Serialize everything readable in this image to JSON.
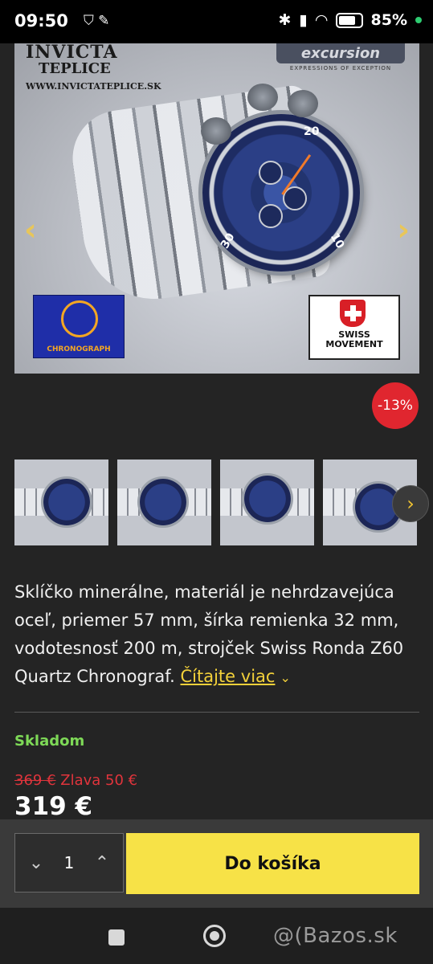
{
  "status_bar": {
    "time": "09:50",
    "battery": "85%"
  },
  "hero": {
    "brand_line1": "INVICTA",
    "brand_line2": "TEPLICE",
    "brand_url": "WWW.INVICTATEPLICE.SK",
    "logo_right": "excursion",
    "logo_right_tagline": "EXPRESSIONS OF EXCEPTION",
    "badge_left": "CHRONOGRAPH",
    "badge_right_line1": "SWISS",
    "badge_right_line2": "MOVEMENT",
    "bezel_numbers": [
      "20",
      "30",
      "10"
    ]
  },
  "discount_badge": "-13%",
  "thumbnails": [
    "thumb-1",
    "thumb-2",
    "thumb-3",
    "thumb-4"
  ],
  "description": {
    "text": "Sklíčko minerálne, materiál je nehrdzavejúca oceľ, priemer 57 mm, šírka remienka 32 mm, vodotesnosť 200 m, strojček Swiss Ronda Z60 Quartz Chronograf.",
    "read_more": "Čítajte viac"
  },
  "stock_status": "Skladom",
  "pricing": {
    "old_price": "369 €",
    "discount_label": "Zlava 50 €",
    "price": "319 €"
  },
  "cart": {
    "quantity": "1",
    "add_to_cart_label": "Do košíka"
  },
  "watermark": "@(Bazos.sk",
  "colors": {
    "accent": "#f7e247",
    "discount": "#e0262f",
    "in_stock": "#7ed957",
    "old_price": "#e0343c"
  }
}
